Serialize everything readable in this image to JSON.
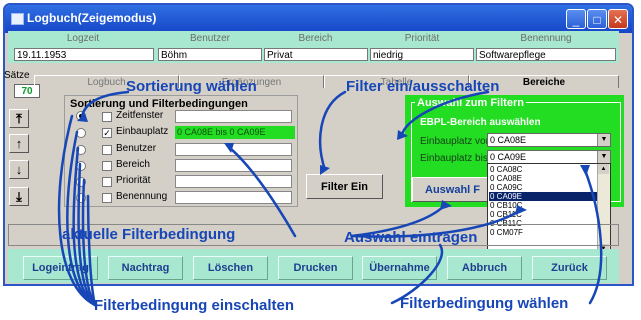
{
  "window": {
    "title": "Logbuch(Zeigemodus)"
  },
  "info": {
    "headers": [
      "Logzeit",
      "Benutzer",
      "Bereich",
      "Priorität",
      "Benennung"
    ],
    "values": [
      "19.11.1953",
      "Böhm",
      "Privat",
      "niedrig",
      "Softwarepflege"
    ]
  },
  "side": {
    "label": "Sätze",
    "count": "70"
  },
  "tabs": [
    "Logbuch",
    "Ergänzungen",
    "Tabelle",
    "Bereiche"
  ],
  "sort": {
    "title": "Sortierung und Filterbedingungen",
    "fields": [
      "Zeitfenster",
      "Einbauplatz",
      "Benutzer",
      "Bereich",
      "Priorität",
      "Benennung"
    ],
    "active_filter": "0 CA08E bis 0 CA09E",
    "filter_button": "Filter Ein"
  },
  "filter_select": {
    "title": "Auswahl zum Filtern",
    "subtitle": "EBPL-Bereich auswählen",
    "from_label": "Einbauplatz von",
    "from_value": "0 CA08E",
    "to_label": "Einbauplatz bis",
    "to_value": "0 CA09E",
    "button_label": "Auswahl F",
    "options": [
      "0 CA08C",
      "0 CA08E",
      "0 CA09C",
      "0 CA09E",
      "0 CB10C",
      "0 CB11C",
      "0 CB11C",
      "0 CM07F"
    ],
    "selected_index": 3
  },
  "buttons": [
    "Logeintrag",
    "Nachtrag",
    "Löschen",
    "Drucken",
    "Übernahme",
    "Abbruch",
    "Zurück"
  ],
  "annotations": {
    "sort": "Sortierung wählen",
    "filter_toggle": "Filter ein/ausschalten",
    "current": "aktuelle Filterbedingung",
    "select": "Auswahl eintragen",
    "enable": "Filterbedingung einschalten",
    "choose": "Filterbedingung wählen"
  },
  "colors": {
    "accent": "#1746b6",
    "filter_green": "#22dd22",
    "panel_mint": "#a8e8d0",
    "titlebar": "#1a52d6"
  }
}
